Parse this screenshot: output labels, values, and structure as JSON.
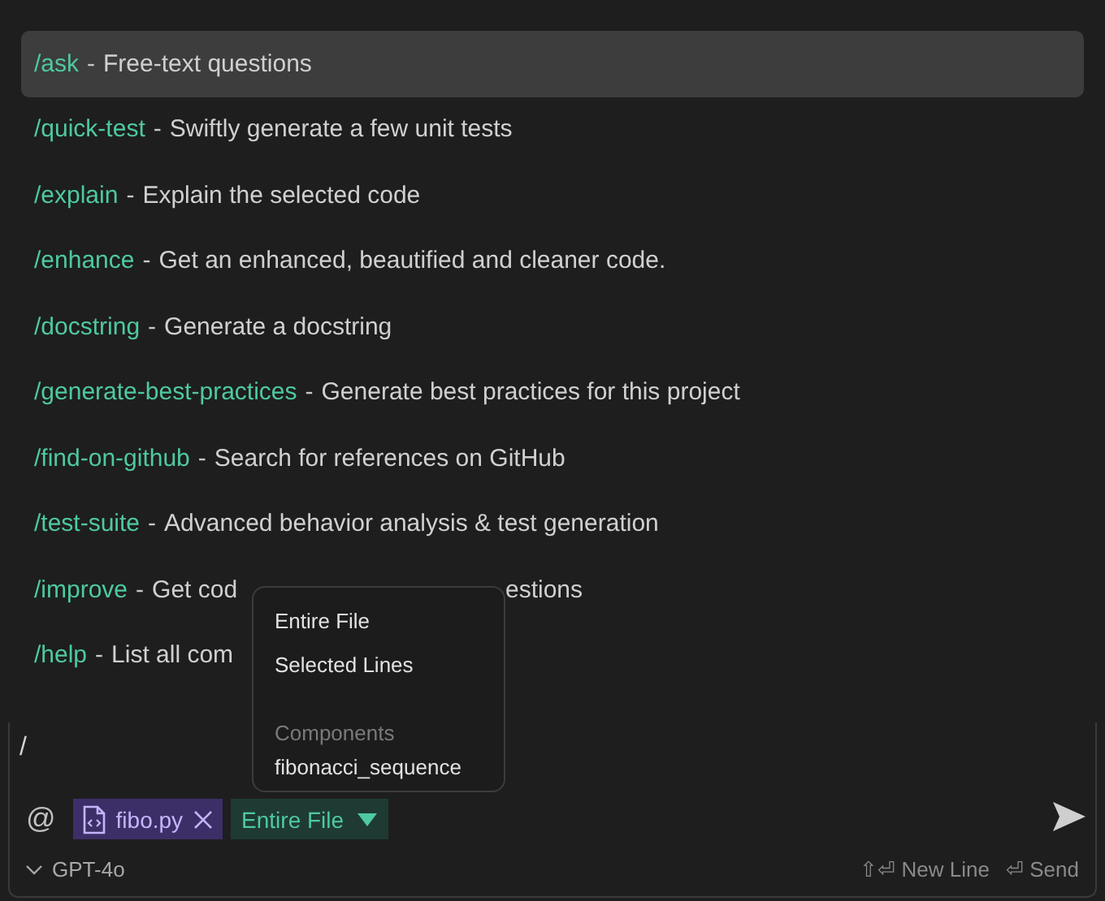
{
  "separator": "-",
  "commands": [
    {
      "command": "/ask",
      "description": "Free-text questions",
      "selected": true
    },
    {
      "command": "/quick-test",
      "description": "Swiftly generate a few unit tests",
      "selected": false
    },
    {
      "command": "/explain",
      "description": "Explain the selected code",
      "selected": false
    },
    {
      "command": "/enhance",
      "description": "Get an enhanced, beautified and cleaner code.",
      "selected": false
    },
    {
      "command": "/docstring",
      "description": "Generate a docstring",
      "selected": false
    },
    {
      "command": "/generate-best-practices",
      "description": "Generate best practices for this project",
      "selected": false
    },
    {
      "command": "/find-on-github",
      "description": "Search for references on GitHub",
      "selected": false
    },
    {
      "command": "/test-suite",
      "description": "Advanced behavior analysis & test generation",
      "selected": false
    },
    {
      "command": "/improve",
      "description": "Get cod",
      "tail": "estions",
      "selected": false
    },
    {
      "command": "/help",
      "description": "List all com",
      "selected": false
    }
  ],
  "scope_menu": [
    {
      "kind": "option",
      "label": "Entire File"
    },
    {
      "kind": "option",
      "label": "Selected Lines"
    },
    {
      "kind": "header",
      "label": "Components"
    },
    {
      "kind": "option",
      "label": "fibonacci_sequence"
    }
  ],
  "input": {
    "value": "/"
  },
  "context": {
    "mention": "@",
    "file": "fibo.py",
    "scope": "Entire File"
  },
  "model": "GPT-4o",
  "hints": [
    {
      "keys": "⇧⏎",
      "label": "New Line"
    },
    {
      "keys": "⏎",
      "label": "Send"
    }
  ]
}
